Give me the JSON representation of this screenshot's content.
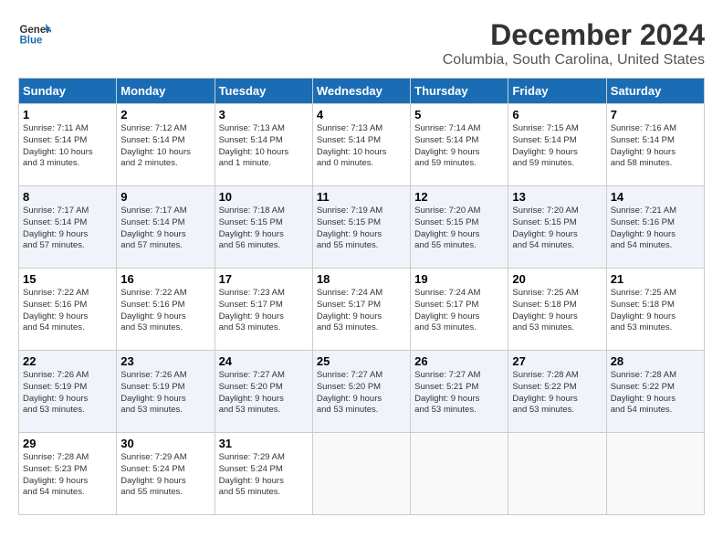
{
  "header": {
    "logo_line1": "General",
    "logo_line2": "Blue",
    "title": "December 2024",
    "subtitle": "Columbia, South Carolina, United States"
  },
  "weekdays": [
    "Sunday",
    "Monday",
    "Tuesday",
    "Wednesday",
    "Thursday",
    "Friday",
    "Saturday"
  ],
  "weeks": [
    [
      {
        "day": "1",
        "info": "Sunrise: 7:11 AM\nSunset: 5:14 PM\nDaylight: 10 hours\nand 3 minutes."
      },
      {
        "day": "2",
        "info": "Sunrise: 7:12 AM\nSunset: 5:14 PM\nDaylight: 10 hours\nand 2 minutes."
      },
      {
        "day": "3",
        "info": "Sunrise: 7:13 AM\nSunset: 5:14 PM\nDaylight: 10 hours\nand 1 minute."
      },
      {
        "day": "4",
        "info": "Sunrise: 7:13 AM\nSunset: 5:14 PM\nDaylight: 10 hours\nand 0 minutes."
      },
      {
        "day": "5",
        "info": "Sunrise: 7:14 AM\nSunset: 5:14 PM\nDaylight: 9 hours\nand 59 minutes."
      },
      {
        "day": "6",
        "info": "Sunrise: 7:15 AM\nSunset: 5:14 PM\nDaylight: 9 hours\nand 59 minutes."
      },
      {
        "day": "7",
        "info": "Sunrise: 7:16 AM\nSunset: 5:14 PM\nDaylight: 9 hours\nand 58 minutes."
      }
    ],
    [
      {
        "day": "8",
        "info": "Sunrise: 7:17 AM\nSunset: 5:14 PM\nDaylight: 9 hours\nand 57 minutes."
      },
      {
        "day": "9",
        "info": "Sunrise: 7:17 AM\nSunset: 5:14 PM\nDaylight: 9 hours\nand 57 minutes."
      },
      {
        "day": "10",
        "info": "Sunrise: 7:18 AM\nSunset: 5:15 PM\nDaylight: 9 hours\nand 56 minutes."
      },
      {
        "day": "11",
        "info": "Sunrise: 7:19 AM\nSunset: 5:15 PM\nDaylight: 9 hours\nand 55 minutes."
      },
      {
        "day": "12",
        "info": "Sunrise: 7:20 AM\nSunset: 5:15 PM\nDaylight: 9 hours\nand 55 minutes."
      },
      {
        "day": "13",
        "info": "Sunrise: 7:20 AM\nSunset: 5:15 PM\nDaylight: 9 hours\nand 54 minutes."
      },
      {
        "day": "14",
        "info": "Sunrise: 7:21 AM\nSunset: 5:16 PM\nDaylight: 9 hours\nand 54 minutes."
      }
    ],
    [
      {
        "day": "15",
        "info": "Sunrise: 7:22 AM\nSunset: 5:16 PM\nDaylight: 9 hours\nand 54 minutes."
      },
      {
        "day": "16",
        "info": "Sunrise: 7:22 AM\nSunset: 5:16 PM\nDaylight: 9 hours\nand 53 minutes."
      },
      {
        "day": "17",
        "info": "Sunrise: 7:23 AM\nSunset: 5:17 PM\nDaylight: 9 hours\nand 53 minutes."
      },
      {
        "day": "18",
        "info": "Sunrise: 7:24 AM\nSunset: 5:17 PM\nDaylight: 9 hours\nand 53 minutes."
      },
      {
        "day": "19",
        "info": "Sunrise: 7:24 AM\nSunset: 5:17 PM\nDaylight: 9 hours\nand 53 minutes."
      },
      {
        "day": "20",
        "info": "Sunrise: 7:25 AM\nSunset: 5:18 PM\nDaylight: 9 hours\nand 53 minutes."
      },
      {
        "day": "21",
        "info": "Sunrise: 7:25 AM\nSunset: 5:18 PM\nDaylight: 9 hours\nand 53 minutes."
      }
    ],
    [
      {
        "day": "22",
        "info": "Sunrise: 7:26 AM\nSunset: 5:19 PM\nDaylight: 9 hours\nand 53 minutes."
      },
      {
        "day": "23",
        "info": "Sunrise: 7:26 AM\nSunset: 5:19 PM\nDaylight: 9 hours\nand 53 minutes."
      },
      {
        "day": "24",
        "info": "Sunrise: 7:27 AM\nSunset: 5:20 PM\nDaylight: 9 hours\nand 53 minutes."
      },
      {
        "day": "25",
        "info": "Sunrise: 7:27 AM\nSunset: 5:20 PM\nDaylight: 9 hours\nand 53 minutes."
      },
      {
        "day": "26",
        "info": "Sunrise: 7:27 AM\nSunset: 5:21 PM\nDaylight: 9 hours\nand 53 minutes."
      },
      {
        "day": "27",
        "info": "Sunrise: 7:28 AM\nSunset: 5:22 PM\nDaylight: 9 hours\nand 53 minutes."
      },
      {
        "day": "28",
        "info": "Sunrise: 7:28 AM\nSunset: 5:22 PM\nDaylight: 9 hours\nand 54 minutes."
      }
    ],
    [
      {
        "day": "29",
        "info": "Sunrise: 7:28 AM\nSunset: 5:23 PM\nDaylight: 9 hours\nand 54 minutes."
      },
      {
        "day": "30",
        "info": "Sunrise: 7:29 AM\nSunset: 5:24 PM\nDaylight: 9 hours\nand 55 minutes."
      },
      {
        "day": "31",
        "info": "Sunrise: 7:29 AM\nSunset: 5:24 PM\nDaylight: 9 hours\nand 55 minutes."
      },
      {
        "day": "",
        "info": ""
      },
      {
        "day": "",
        "info": ""
      },
      {
        "day": "",
        "info": ""
      },
      {
        "day": "",
        "info": ""
      }
    ]
  ]
}
